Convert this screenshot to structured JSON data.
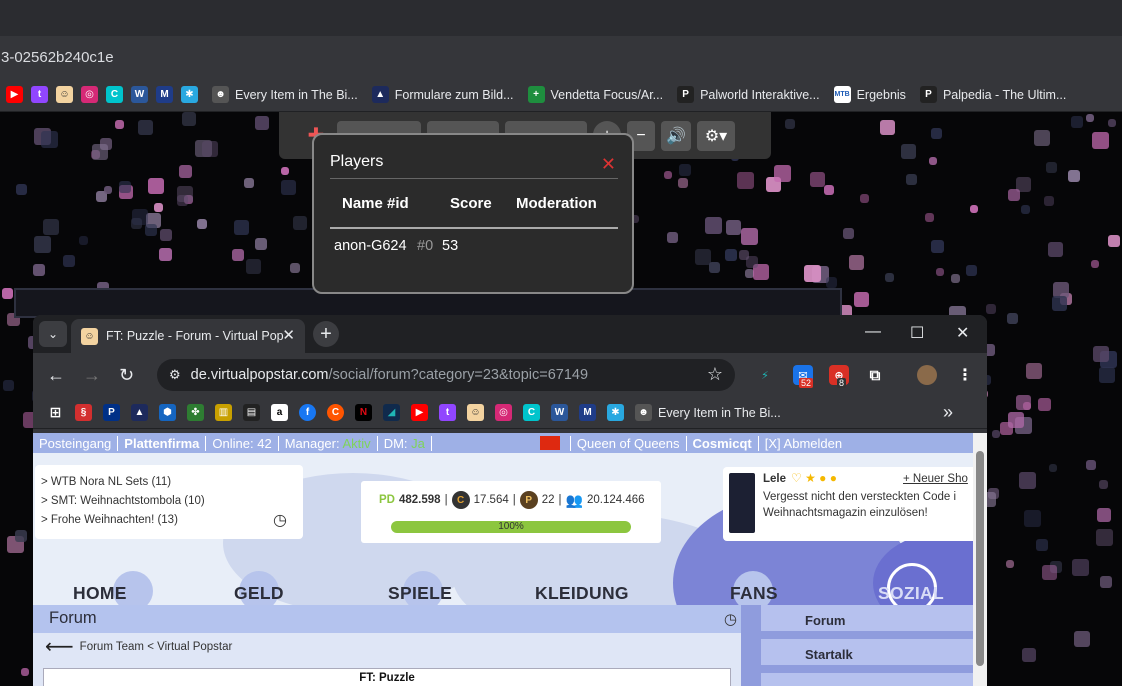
{
  "outer_browser": {
    "url_fragment": "3-02562b240c1e",
    "bookmarks": [
      {
        "label": "Every Item in The Bi...",
        "icon": "mask-icon"
      },
      {
        "label": "Formulare zum Bild...",
        "icon": "eagle-icon"
      },
      {
        "label": "Vendetta Focus/Ar...",
        "icon": "plus-icon"
      },
      {
        "label": "Palworld Interaktive...",
        "icon": "p-icon"
      },
      {
        "label": "Ergebnis",
        "icon": "mtb-icon"
      },
      {
        "label": "Palpedia - The Ultim...",
        "icon": "p-icon"
      }
    ]
  },
  "players_dialog": {
    "title": "Players",
    "close": "✕",
    "columns": [
      "Name #id",
      "Score",
      "Moderation"
    ],
    "rows": [
      {
        "name": "anon-G624",
        "id": "#0",
        "score": "53"
      }
    ]
  },
  "front_browser": {
    "tab_title": "FT: Puzzle - Forum - Virtual Pop",
    "url_host": "de.virtualpopstar.com",
    "url_path": "/social/forum?category=23&topic=67149",
    "ext_badges": {
      "mail": "52",
      "notif": "8"
    },
    "bookmark_label": "Every Item in The Bi...",
    "more": "»"
  },
  "page": {
    "topbar": {
      "inbox": "Posteingang",
      "label": "Plattenfirma",
      "online": "Online: 42",
      "manager_label": "Manager:",
      "manager_value": "Aktiv",
      "dm_label": "DM:",
      "dm_value": "Ja",
      "queen": "Queen of Queens",
      "user": "Cosmicqt",
      "logout": "[X] Abmelden"
    },
    "threads": [
      "> WTB Nora NL Sets (11)",
      "> SMT: Weihnachtstombola (10)",
      "> Frohe Weihnachten! (13)"
    ],
    "stats": {
      "pd": "482.598",
      "coins": "17.564",
      "p": "22",
      "fans": "20.124.466",
      "progress": "100%",
      "progress_value": 100
    },
    "profile": {
      "name": "Lele",
      "new_show": "+ Neuer Sho",
      "message_line1": "Vergesst nicht den versteckten Code i",
      "message_line2": "Weihnachtsmagazin einzulösen!"
    },
    "nav": [
      "HOME",
      "GELD",
      "SPIELE",
      "KLEIDUNG",
      "FANS",
      "SOZIAL"
    ],
    "forum_title": "Forum",
    "breadcrumb": "Forum Team < Virtual Popstar",
    "thread_title": "FT: Puzzle",
    "side_menu": [
      "Forum",
      "Startalk"
    ]
  }
}
